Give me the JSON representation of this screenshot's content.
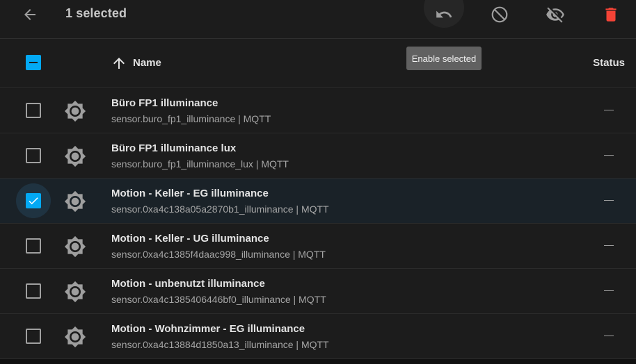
{
  "toolbar": {
    "selected_label": "1 selected",
    "icons": {
      "back": "arrow-left-icon",
      "enable": "undo-icon",
      "disable": "block-icon",
      "hide": "eye-off-icon",
      "remove": "trash-icon"
    },
    "trash_color": "#f44336"
  },
  "tooltip": {
    "text": "Enable selected"
  },
  "table": {
    "header": {
      "name_label": "Name",
      "status_label": "Status",
      "sort": "ascending"
    },
    "accent": "#03a9f4",
    "rows": [
      {
        "title": "Büro FP1 illuminance",
        "subtitle": "sensor.buro_fp1_illuminance | MQTT",
        "status": "—",
        "checked": false,
        "icon": "brightness-icon"
      },
      {
        "title": "Büro FP1 illuminance lux",
        "subtitle": "sensor.buro_fp1_illuminance_lux | MQTT",
        "status": "—",
        "checked": false,
        "icon": "brightness-icon"
      },
      {
        "title": "Motion - Keller - EG illuminance",
        "subtitle": "sensor.0xa4c138a05a2870b1_illuminance | MQTT",
        "status": "—",
        "checked": true,
        "icon": "brightness-icon"
      },
      {
        "title": "Motion - Keller - UG illuminance",
        "subtitle": "sensor.0xa4c1385f4daac998_illuminance | MQTT",
        "status": "—",
        "checked": false,
        "icon": "brightness-icon"
      },
      {
        "title": "Motion - unbenutzt illuminance",
        "subtitle": "sensor.0xa4c1385406446bf0_illuminance | MQTT",
        "status": "—",
        "checked": false,
        "icon": "brightness-icon"
      },
      {
        "title": "Motion - Wohnzimmer - EG illuminance",
        "subtitle": "sensor.0xa4c13884d1850a13_illuminance | MQTT",
        "status": "—",
        "checked": false,
        "icon": "brightness-icon"
      }
    ]
  }
}
